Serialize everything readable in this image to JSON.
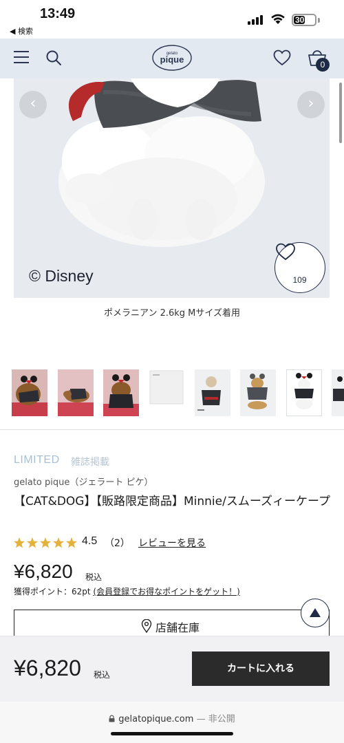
{
  "status_bar": {
    "time": "13:49",
    "back_label": "◀ 検索",
    "battery": "30"
  },
  "header": {
    "logo_top": "gelato",
    "logo_bottom": "pique",
    "cart_count": "0",
    "icons": [
      "menu-icon",
      "search-icon",
      "heart-icon",
      "cart-icon"
    ]
  },
  "gallery": {
    "copyright": "© Disney",
    "favorite_count": "109",
    "prev_glyph": "‹",
    "next_glyph": "›",
    "caption": "ポメラニアン 2.6kg Mサイズ着用",
    "thumbnail_count": 8
  },
  "product": {
    "tag_limited": "LIMITED",
    "tag_magazine": "雑誌掲載",
    "brand": "gelato pique（ジェラート ピケ）",
    "title": "【CAT&DOG】【販路限定商品】Minnie/スムーズィーケープ",
    "rating_value": 4.5,
    "rating_text": "4.5",
    "review_count": "（2）",
    "review_link": "レビューを見る",
    "price": "¥6,820",
    "tax_label": "税込",
    "points_label": "獲得ポイント：62pt",
    "points_link": "(会員登録でお得なポイントをゲット！)",
    "store_stock_button": "店舗在庫"
  },
  "buy_bar": {
    "price": "¥6,820",
    "tax_label": "税込",
    "add_to_cart": "カートに入れる"
  },
  "browser": {
    "domain": "gelatopique.com",
    "visibility": "— 非公開"
  },
  "colors": {
    "header_bg": "#e3e9f1",
    "navy": "#1f2a44",
    "star": "#e3b23c",
    "limited_tag": "#a9c0d4",
    "cart_button": "#2b2b2b"
  }
}
